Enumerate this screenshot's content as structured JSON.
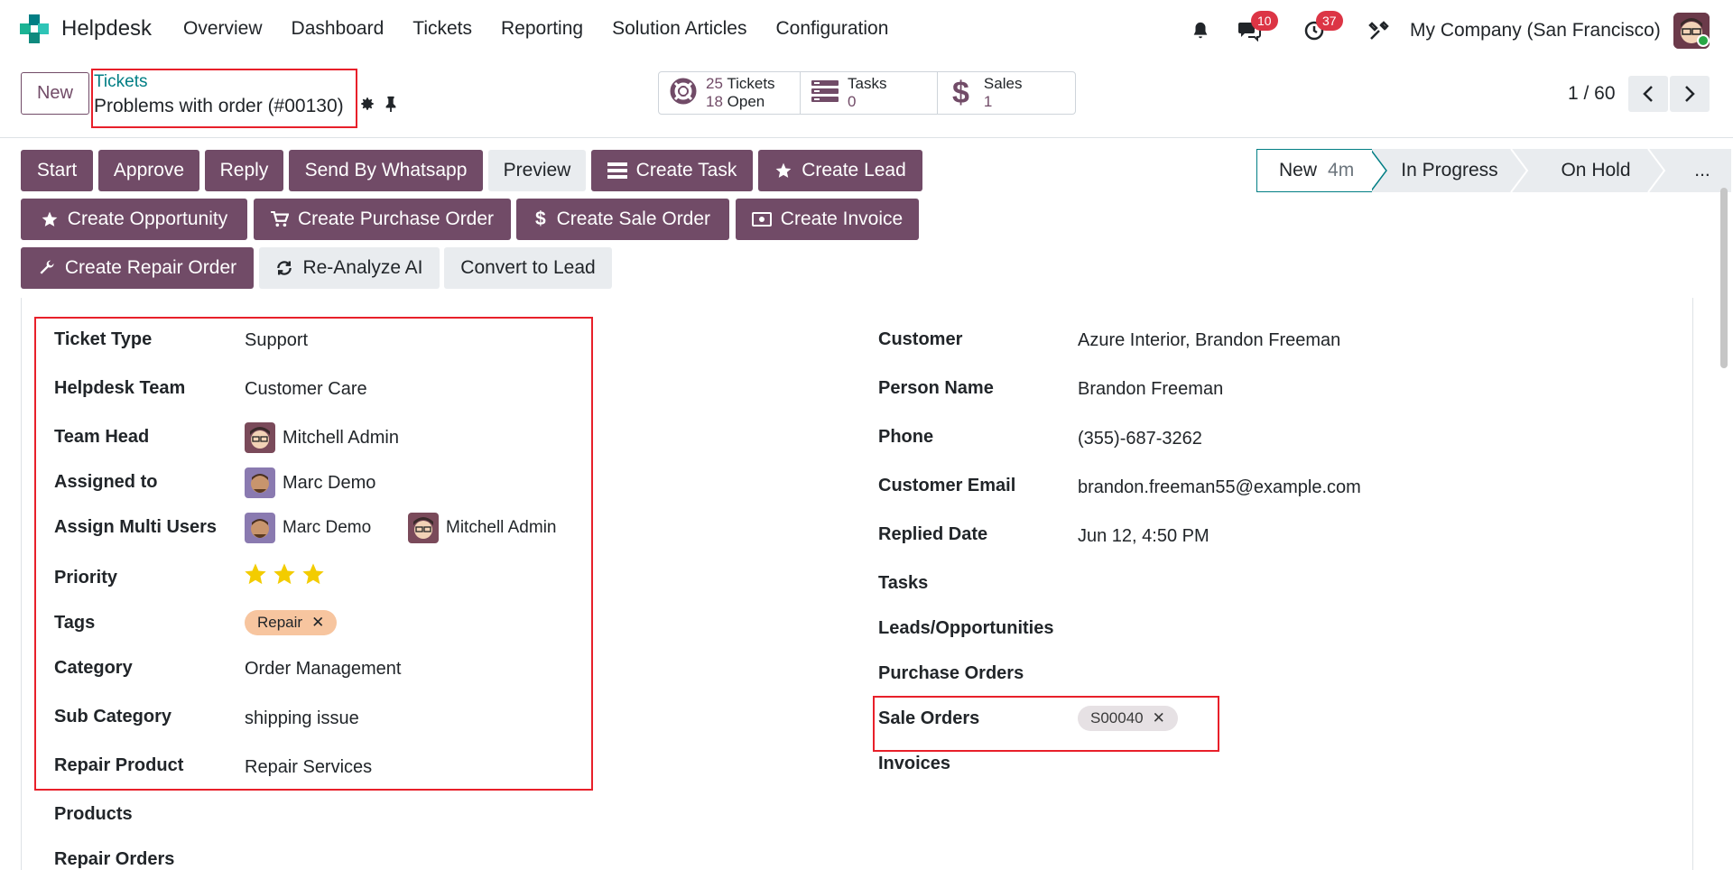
{
  "app": {
    "brand": "Helpdesk",
    "menu": [
      "Overview",
      "Dashboard",
      "Tickets",
      "Reporting",
      "Solution Articles",
      "Configuration"
    ],
    "notifications": {
      "messages_count": "10",
      "activities_count": "37"
    },
    "company": "My Company (San Francisco)"
  },
  "control": {
    "new_label": "New",
    "breadcrumb_parent": "Tickets",
    "record_title": "Problems with order (#00130)",
    "stats": {
      "tickets_count": "25",
      "tickets_label": "Tickets",
      "open_count": "18",
      "open_label": "Open",
      "tasks_label": "Tasks",
      "tasks_count": "0",
      "sales_label": "Sales",
      "sales_count": "1"
    },
    "pager": "1 / 60"
  },
  "actions": {
    "start": "Start",
    "approve": "Approve",
    "reply": "Reply",
    "send_whatsapp": "Send By Whatsapp",
    "preview": "Preview",
    "create_task": "Create Task",
    "create_lead": "Create Lead",
    "create_opportunity": "Create Opportunity",
    "create_purchase_order": "Create Purchase Order",
    "create_sale_order": "Create Sale Order",
    "create_invoice": "Create Invoice",
    "create_repair_order": "Create Repair Order",
    "reanalyze_ai": "Re-Analyze AI",
    "convert_to_lead": "Convert to Lead"
  },
  "status": {
    "current": "New",
    "duration": "4m",
    "stages": [
      "In Progress",
      "On Hold",
      "..."
    ]
  },
  "form": {
    "left": {
      "ticket_type": {
        "label": "Ticket Type",
        "value": "Support"
      },
      "helpdesk_team": {
        "label": "Helpdesk Team",
        "value": "Customer Care"
      },
      "team_head": {
        "label": "Team Head",
        "value": "Mitchell Admin"
      },
      "assigned_to": {
        "label": "Assigned to",
        "value": "Marc Demo"
      },
      "assign_multi": {
        "label": "Assign Multi Users",
        "user1": "Marc Demo",
        "user2": "Mitchell Admin"
      },
      "priority": {
        "label": "Priority",
        "stars": 3
      },
      "tags": {
        "label": "Tags",
        "tag": "Repair"
      },
      "category": {
        "label": "Category",
        "value": "Order Management"
      },
      "sub_category": {
        "label": "Sub Category",
        "value": "shipping issue"
      },
      "repair_product": {
        "label": "Repair Product",
        "value": "Repair Services"
      },
      "products": {
        "label": "Products"
      },
      "repair_orders": {
        "label": "Repair Orders"
      }
    },
    "right": {
      "customer": {
        "label": "Customer",
        "value": "Azure Interior, Brandon Freeman"
      },
      "person_name": {
        "label": "Person Name",
        "value": "Brandon Freeman"
      },
      "phone": {
        "label": "Phone",
        "value": "(355)-687-3262"
      },
      "customer_email": {
        "label": "Customer Email",
        "value": "brandon.freeman55@example.com"
      },
      "replied_date": {
        "label": "Replied Date",
        "value": "Jun 12, 4:50 PM"
      },
      "tasks": {
        "label": "Tasks"
      },
      "leads": {
        "label": "Leads/Opportunities"
      },
      "purchase_orders": {
        "label": "Purchase Orders"
      },
      "sale_orders": {
        "label": "Sale Orders",
        "tag": "S00040"
      },
      "invoices": {
        "label": "Invoices"
      }
    }
  },
  "colors": {
    "primary": "#714b67",
    "teal": "#017e84",
    "highlight": "#e8202a",
    "star": "#f3cc00",
    "tag_repair": "#f7c59f"
  }
}
